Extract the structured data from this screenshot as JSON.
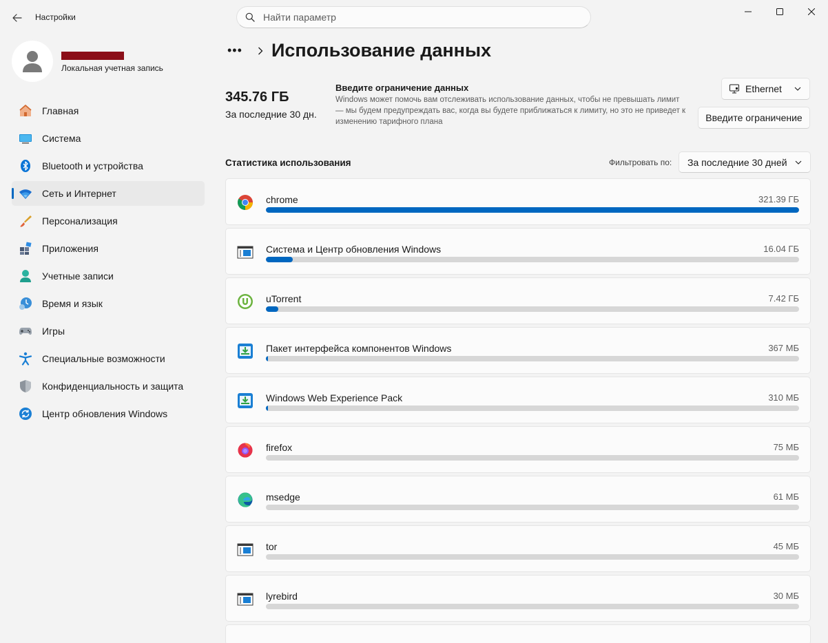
{
  "window": {
    "title": "Настройки",
    "search_placeholder": "Найти параметр"
  },
  "profile": {
    "account_type": "Локальная учетная запись"
  },
  "sidebar": {
    "items": [
      {
        "label": "Главная",
        "icon": "home-icon"
      },
      {
        "label": "Система",
        "icon": "system-icon"
      },
      {
        "label": "Bluetooth и устройства",
        "icon": "bluetooth-icon"
      },
      {
        "label": "Сеть и Интернет",
        "icon": "wifi-icon",
        "active": true
      },
      {
        "label": "Персонализация",
        "icon": "brush-icon"
      },
      {
        "label": "Приложения",
        "icon": "apps-icon"
      },
      {
        "label": "Учетные записи",
        "icon": "accounts-icon"
      },
      {
        "label": "Время и язык",
        "icon": "time-language-icon"
      },
      {
        "label": "Игры",
        "icon": "gamepad-icon"
      },
      {
        "label": "Специальные возможности",
        "icon": "accessibility-icon"
      },
      {
        "label": "Конфиденциальность и защита",
        "icon": "shield-icon"
      },
      {
        "label": "Центр обновления Windows",
        "icon": "update-icon"
      }
    ]
  },
  "header": {
    "breadcrumb_more": "•••",
    "title": "Использование данных"
  },
  "summary": {
    "total": "345.76 ГБ",
    "period": "За последние 30 дн.",
    "limit_title": "Введите ограничение данных",
    "limit_description": "Windows может помочь вам отслеживать использование данных, чтобы не превышать лимит — мы будем предупреждать вас, когда вы будете приближаться к лимиту, но это не приведет к изменению тарифного плана",
    "network_select": "Ethernet",
    "limit_button": "Введите ограничение"
  },
  "stats": {
    "title": "Статистика использования",
    "filter_label": "Фильтровать по:",
    "filter_value": "За последние 30 дней",
    "apps": [
      {
        "name": "chrome",
        "usage": "321.39 ГБ",
        "fraction": 1.0,
        "icon": "chrome-icon"
      },
      {
        "name": "Система и Центр обновления Windows",
        "usage": "16.04 ГБ",
        "fraction": 0.05,
        "icon": "system-window-icon"
      },
      {
        "name": "uTorrent",
        "usage": "7.42 ГБ",
        "fraction": 0.023,
        "icon": "utorrent-icon"
      },
      {
        "name": "Пакет интерфейса компонентов Windows",
        "usage": "367 МБ",
        "fraction": 0.0015,
        "icon": "windows-package-icon"
      },
      {
        "name": "Windows Web Experience Pack",
        "usage": "310 МБ",
        "fraction": 0.0013,
        "icon": "windows-package-icon"
      },
      {
        "name": "firefox",
        "usage": "75 МБ",
        "fraction": 0.0,
        "icon": "firefox-icon"
      },
      {
        "name": "msedge",
        "usage": "61 МБ",
        "fraction": 0.0,
        "icon": "edge-icon"
      },
      {
        "name": "tor",
        "usage": "45 МБ",
        "fraction": 0.0,
        "icon": "system-window-icon"
      },
      {
        "name": "lyrebird",
        "usage": "30 МБ",
        "fraction": 0.0,
        "icon": "system-window-icon"
      }
    ]
  },
  "colors": {
    "accent": "#0067c0",
    "redaction": "#8b0f19"
  }
}
